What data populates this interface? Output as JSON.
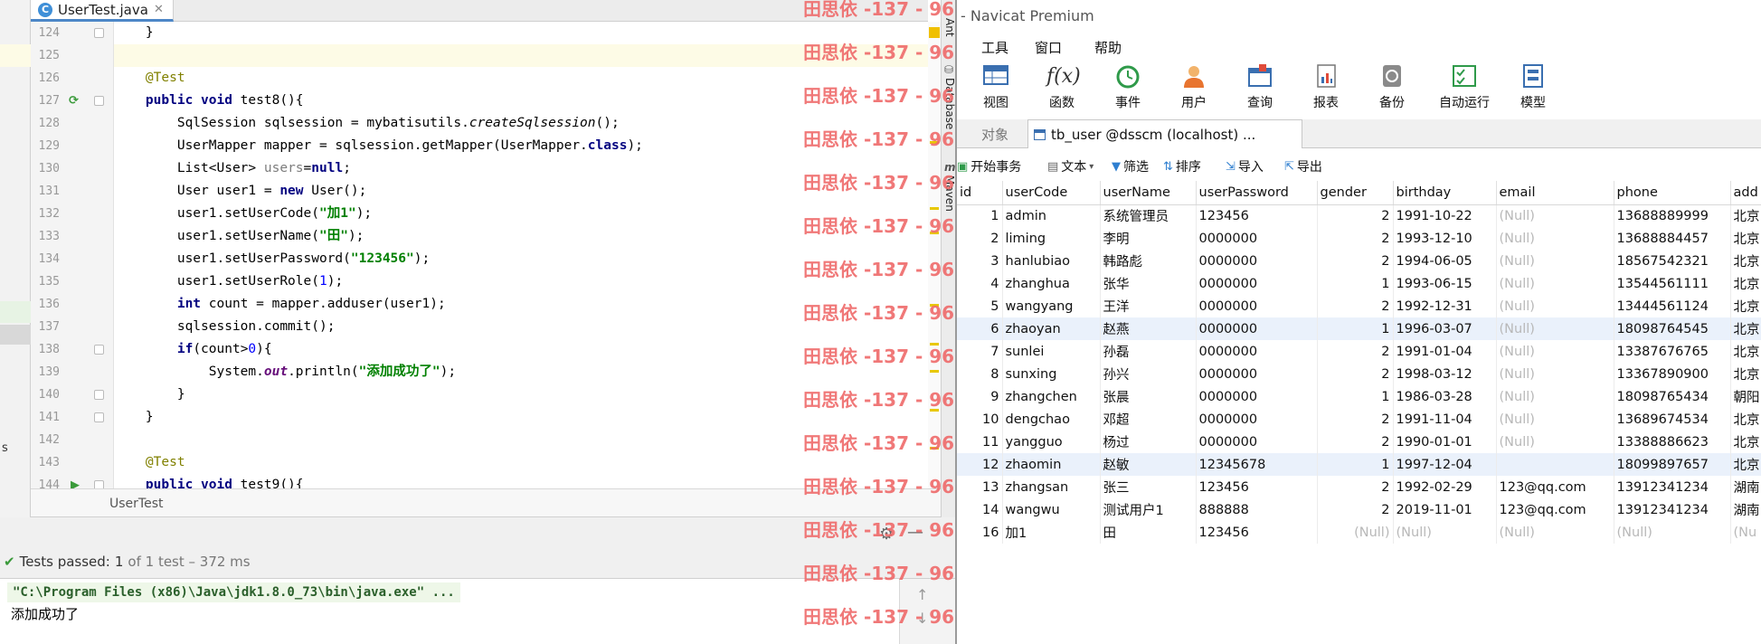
{
  "ide": {
    "tab_title": "UserTest.java",
    "breadcrumb": "UserTest",
    "left_letter": "s",
    "side_tools": [
      "Ant",
      "Database",
      "Maven"
    ],
    "code_lines": [
      {
        "num": "124",
        "html": "    }"
      },
      {
        "num": "125",
        "html": ""
      },
      {
        "num": "126",
        "html": "    <span class='ann'>@Test</span>"
      },
      {
        "num": "127",
        "html": "    <span class='kw'>public void</span> test8(){"
      },
      {
        "num": "128",
        "html": "        SqlSession sqlsession = mybatisutils.<span class='it'>createSqlsession</span>();"
      },
      {
        "num": "129",
        "html": "        UserMapper mapper = sqlsession.getMapper(UserMapper.<span class='kw'>class</span>);"
      },
      {
        "num": "130",
        "html": "        List&lt;User&gt; <span class='gray'>users</span>=<span class='kw'>null</span>;"
      },
      {
        "num": "131",
        "html": "        User user1 = <span class='kw'>new</span> User();"
      },
      {
        "num": "132",
        "html": "        user1.setUserCode(<span class='str'>\"加1\"</span>);"
      },
      {
        "num": "133",
        "html": "        user1.setUserName(<span class='str'>\"田\"</span>);"
      },
      {
        "num": "134",
        "html": "        user1.setUserPassword(<span class='str'>\"123456\"</span>);"
      },
      {
        "num": "135",
        "html": "        user1.setUserRole(<span class='num'>1</span>);"
      },
      {
        "num": "136",
        "html": "        <span class='kw'>int</span> count = mapper.adduser(user1);"
      },
      {
        "num": "137",
        "html": "        sqlsession.commit();"
      },
      {
        "num": "138",
        "html": "        <span class='kw'>if</span>(count&gt;<span class='num'>0</span>){"
      },
      {
        "num": "139",
        "html": "            System.<span class='field'>out</span>.println(<span class='str'>\"添加成功了\"</span>);"
      },
      {
        "num": "140",
        "html": "        }"
      },
      {
        "num": "141",
        "html": "    }"
      },
      {
        "num": "142",
        "html": ""
      },
      {
        "num": "143",
        "html": "    <span class='ann'>@Test</span>"
      },
      {
        "num": "144",
        "html": "    <span class='kw'>public void</span> test9(){"
      }
    ],
    "test_status": {
      "label": "Tests passed:",
      "count": "1",
      "detail": "of 1 test – 372 ms"
    },
    "console": {
      "cmd": "\"C:\\Program Files (x86)\\Java\\jdk1.8.0_73\\bin\\java.exe\" ...",
      "output": "添加成功了"
    },
    "watermark": "田思依 -137 - 965"
  },
  "navicat": {
    "title": "- Navicat Premium",
    "menu": [
      "工具",
      "窗口",
      "帮助"
    ],
    "toolbar": [
      {
        "label": "视图",
        "icon": "view-icon"
      },
      {
        "label": "函数",
        "icon": "function-icon"
      },
      {
        "label": "事件",
        "icon": "event-clock-icon"
      },
      {
        "label": "用户",
        "icon": "user-icon"
      },
      {
        "label": "查询",
        "icon": "query-icon"
      },
      {
        "label": "报表",
        "icon": "report-icon"
      },
      {
        "label": "备份",
        "icon": "backup-icon"
      },
      {
        "label": "自动运行",
        "icon": "automation-icon"
      },
      {
        "label": "模型",
        "icon": "model-icon"
      }
    ],
    "tab_objects": "对象",
    "tab_table": "tb_user @dsscm (localhost) ...",
    "actions": [
      "开始事务",
      "文本",
      "筛选",
      "排序",
      "导入",
      "导出"
    ],
    "columns": [
      "id",
      "userCode",
      "userName",
      "userPassword",
      "gender",
      "birthday",
      "email",
      "phone",
      "add"
    ],
    "rows": [
      [
        "1",
        "admin",
        "系统管理员",
        "123456",
        "2",
        "1991-10-22",
        "(Null)",
        "13688889999",
        "北京"
      ],
      [
        "2",
        "liming",
        "李明",
        "0000000",
        "2",
        "1993-12-10",
        "(Null)",
        "13688884457",
        "北京"
      ],
      [
        "3",
        "hanlubiao",
        "韩路彪",
        "0000000",
        "2",
        "1994-06-05",
        "(Null)",
        "18567542321",
        "北京"
      ],
      [
        "4",
        "zhanghua",
        "张华",
        "0000000",
        "1",
        "1993-06-15",
        "(Null)",
        "13544561111",
        "北京"
      ],
      [
        "5",
        "wangyang",
        "王洋",
        "0000000",
        "2",
        "1992-12-31",
        "(Null)",
        "13444561124",
        "北京"
      ],
      [
        "6",
        "zhaoyan",
        "赵燕",
        "0000000",
        "1",
        "1996-03-07",
        "(Null)",
        "18098764545",
        "北京"
      ],
      [
        "7",
        "sunlei",
        "孙磊",
        "0000000",
        "2",
        "1991-01-04",
        "(Null)",
        "13387676765",
        "北京"
      ],
      [
        "8",
        "sunxing",
        "孙兴",
        "0000000",
        "2",
        "1998-03-12",
        "(Null)",
        "13367890900",
        "北京"
      ],
      [
        "9",
        "zhangchen",
        "张晨",
        "0000000",
        "1",
        "1986-03-28",
        "(Null)",
        "18098765434",
        "朝阳"
      ],
      [
        "10",
        "dengchao",
        "邓超",
        "0000000",
        "2",
        "1991-11-04",
        "(Null)",
        "13689674534",
        "北京"
      ],
      [
        "11",
        "yangguo",
        "杨过",
        "0000000",
        "2",
        "1990-01-01",
        "(Null)",
        "13388886623",
        "北京"
      ],
      [
        "12",
        "zhaomin",
        "赵敏",
        "12345678",
        "1",
        "1997-12-04",
        "",
        "18099897657",
        "北京"
      ],
      [
        "13",
        "zhangsan",
        "张三",
        "123456",
        "2",
        "1992-02-29",
        "123@qq.com",
        "13912341234",
        "湖南"
      ],
      [
        "14",
        "wangwu",
        "测试用户1",
        "888888",
        "2",
        "2019-11-01",
        "123@qq.com",
        "13912341234",
        "湖南"
      ],
      [
        "16",
        "加1",
        "田",
        "123456",
        "(Null)",
        "(Null)",
        "(Null)",
        "(Null)",
        "(Nu"
      ]
    ]
  }
}
